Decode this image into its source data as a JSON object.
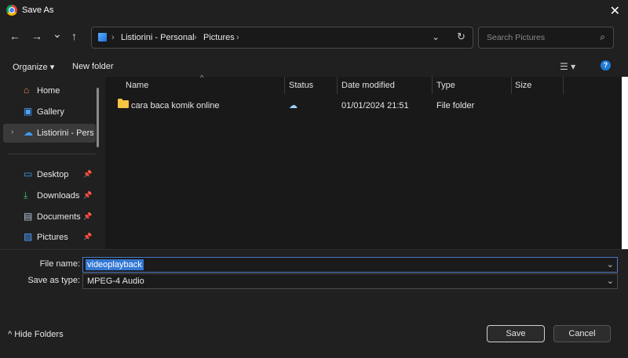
{
  "window": {
    "title": "Save As",
    "close_glyph": "✕"
  },
  "nav": {
    "back": "←",
    "forward": "→",
    "recent": "⌄",
    "up": "↑",
    "breadcrumb": [
      "Listiorini - Personal",
      "Pictures"
    ],
    "separator": "›",
    "dropdown_glyph": "⌄",
    "refresh_glyph": "↻",
    "search_placeholder": "Search Pictures",
    "search_glyph": "⌕"
  },
  "commands": {
    "organize": "Organize ▾",
    "new_folder": "New folder",
    "view_glyph": "☰ ▾",
    "help": "?"
  },
  "sidebar": {
    "items": [
      {
        "label": "Home",
        "icon": "home-icon",
        "glyph": "⌂",
        "pinned": false
      },
      {
        "label": "Gallery",
        "icon": "gallery-icon",
        "glyph": "▣",
        "pinned": false
      },
      {
        "label": "Listiorini - Personal",
        "icon": "onedrive-icon",
        "glyph": "☁",
        "pinned": false,
        "selected": true
      },
      {
        "label": "Desktop",
        "icon": "desktop-icon",
        "glyph": "▭",
        "pinned": true
      },
      {
        "label": "Downloads",
        "icon": "downloads-icon",
        "glyph": "⤓",
        "pinned": true
      },
      {
        "label": "Documents",
        "icon": "documents-icon",
        "glyph": "▤",
        "pinned": true
      },
      {
        "label": "Pictures",
        "icon": "pictures-icon",
        "glyph": "▨",
        "pinned": true
      }
    ],
    "pin_glyph": "📌",
    "expander_glyph": "›"
  },
  "columns": {
    "name": "Name",
    "status": "Status",
    "date": "Date modified",
    "type": "Type",
    "size": "Size",
    "sort_glyph": "^"
  },
  "files": [
    {
      "name": "cara baca komik online",
      "status_glyph": "☁",
      "date": "01/01/2024 21:51",
      "type": "File folder",
      "size": ""
    }
  ],
  "form": {
    "file_name_label": "File name:",
    "file_name_value": "videoplayback",
    "type_label": "Save as type:",
    "type_value": "MPEG-4 Audio",
    "dropdown_glyph": "⌄"
  },
  "footer": {
    "hide_folders": "^  Hide Folders",
    "save": "Save",
    "cancel": "Cancel"
  }
}
